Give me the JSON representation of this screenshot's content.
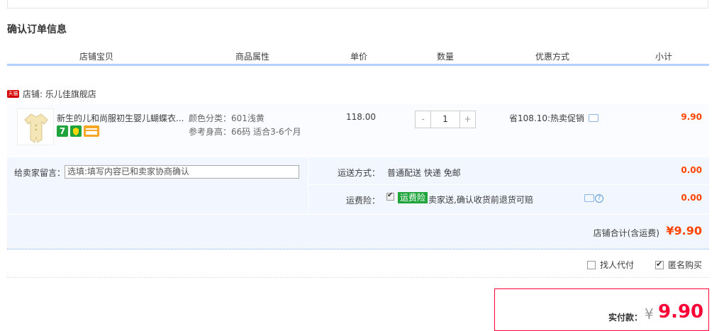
{
  "page": {
    "title": "确认订单信息"
  },
  "table_header": [
    "店铺宝贝",
    "商品属性",
    "单价",
    "数量",
    "优惠方式",
    "小计"
  ],
  "shop": {
    "badge": "天猫",
    "label": "店铺: 乐儿佳旗舰店"
  },
  "item": {
    "title": "新生的儿和尚服初生婴儿蝴蝶衣...",
    "attr_color": "颜色分类：601浅黄",
    "attr_size": "参考身高：66码 适合3-6个月",
    "price": "118.00",
    "qty_minus": "-",
    "qty_value": "1",
    "qty_plus": "+",
    "promo": "省108.10:热卖促销",
    "subtotal": "9.90",
    "badge_7": "7"
  },
  "message": {
    "label": "给卖家留言：",
    "placeholder": "选填:填写内容已和卖家协商确认"
  },
  "shipping": {
    "label": "运送方式：",
    "value": "普通配送 快递 免邮",
    "price": "0.00"
  },
  "insurance": {
    "label": "运费险：",
    "tag": "运费险",
    "text": "卖家送,确认收货前退货可赔",
    "price": "0.00",
    "help": "?"
  },
  "store_total": {
    "label": "店铺合计(含运费)",
    "value": "¥9.90"
  },
  "options": {
    "proxy_pay": "找人代付",
    "anonymous": "匿名购买",
    "anonymous_checked": true
  },
  "payment": {
    "label": "实付款：",
    "yen": "¥",
    "value": "9.90"
  },
  "colors": {
    "accent_red": "#ff4400",
    "price_red": "#ff0036",
    "header_line": "#b2d1ff",
    "row_bg": "#f2f7ff"
  }
}
